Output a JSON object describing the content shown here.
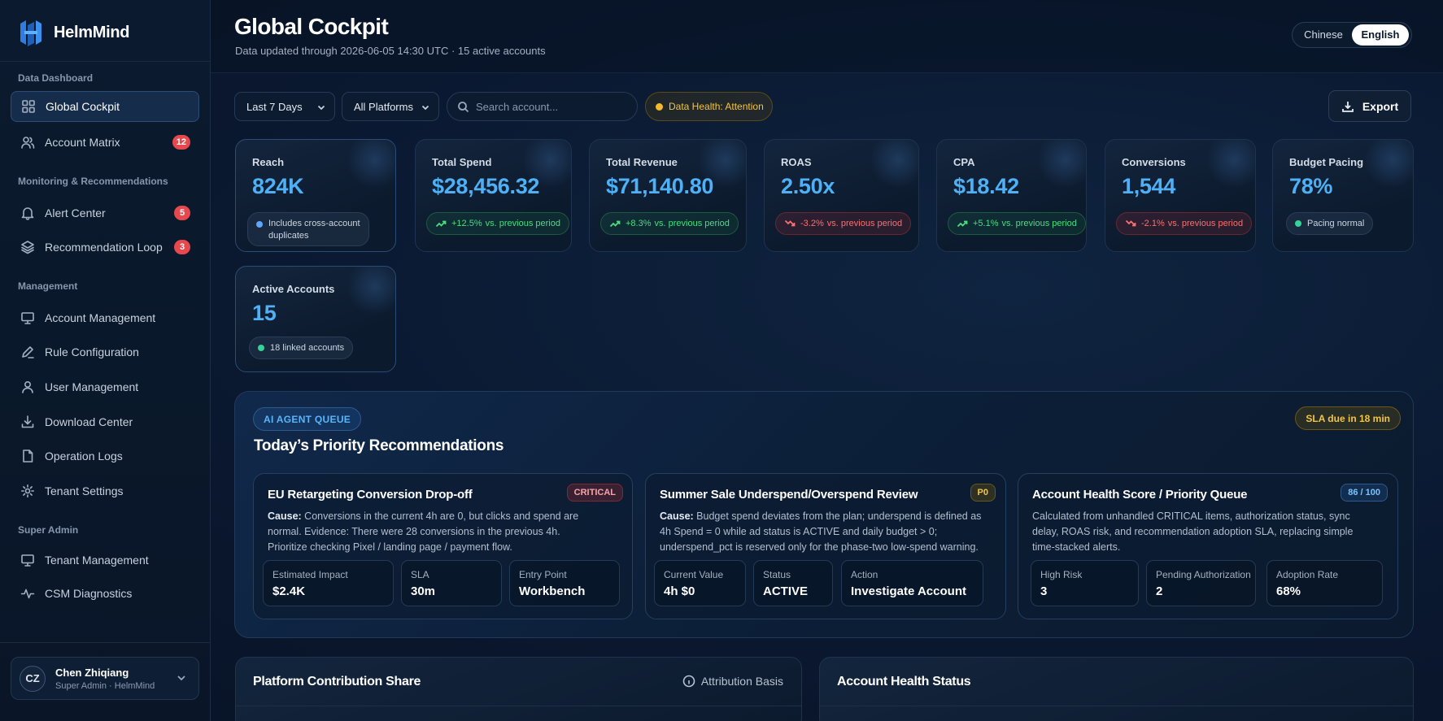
{
  "brand": {
    "name": "HelmMind"
  },
  "sidebar": {
    "sections": [
      {
        "label": "Data Dashboard"
      },
      {
        "label": "Monitoring & Recommendations"
      },
      {
        "label": "Management"
      },
      {
        "label": "Super Admin"
      }
    ],
    "items": [
      {
        "label": "Global Cockpit",
        "icon": "grid-icon",
        "active": true
      },
      {
        "label": "Account Matrix",
        "icon": "users-icon",
        "badge": "12"
      },
      {
        "label": "Alert Center",
        "icon": "bell-icon",
        "badge": "5"
      },
      {
        "label": "Recommendation Loop",
        "icon": "layers-icon",
        "badge": "3"
      },
      {
        "label": "Account Management",
        "icon": "monitor-icon"
      },
      {
        "label": "Rule Configuration",
        "icon": "pen-icon"
      },
      {
        "label": "User Management",
        "icon": "user-icon"
      },
      {
        "label": "Download Center",
        "icon": "download-icon"
      },
      {
        "label": "Operation Logs",
        "icon": "file-icon"
      },
      {
        "label": "Tenant Settings",
        "icon": "gear-icon"
      },
      {
        "label": "Tenant Management",
        "icon": "monitor-icon"
      },
      {
        "label": "CSM Diagnostics",
        "icon": "activity-icon"
      }
    ]
  },
  "user": {
    "initials": "CZ",
    "name": "Chen Zhiqiang",
    "role": "Super Admin · HelmMind"
  },
  "header": {
    "title": "Global Cockpit",
    "subtitle": "Data updated through 2026-06-05 14:30 UTC · 15 active accounts",
    "languages": [
      "Chinese",
      "English"
    ],
    "language_selected": "English"
  },
  "filters": {
    "date_range": "Last 7 Days",
    "platform": "All Platforms",
    "search_placeholder": "Search account...",
    "data_health": "Data Health: Attention",
    "export_label": "Export"
  },
  "kpis": [
    {
      "label": "Reach",
      "value": "824K",
      "note_line1": "Includes cross-account",
      "note_line2": "duplicates",
      "trend": "neutral"
    },
    {
      "label": "Total Spend",
      "value": "$28,456.32",
      "change": "+12.5%",
      "compare": "vs. previous period",
      "trend": "up"
    },
    {
      "label": "Total Revenue",
      "value": "$71,140.80",
      "change": "+8.3%",
      "compare": "vs. previous period",
      "trend": "up"
    },
    {
      "label": "ROAS",
      "value": "2.50x",
      "change": "-3.2%",
      "compare": "vs. previous period",
      "trend": "down"
    },
    {
      "label": "CPA",
      "value": "$18.42",
      "change": "+5.1%",
      "compare": "vs. previous period",
      "trend": "up"
    },
    {
      "label": "Conversions",
      "value": "1,544",
      "change": "-2.1%",
      "compare": "vs. previous period",
      "trend": "down"
    },
    {
      "label": "Budget Pacing",
      "value": "78%",
      "note_line1": "Pacing normal",
      "trend": "neutral"
    },
    {
      "label": "Active Accounts",
      "value": "15",
      "note_line1": "18 linked accounts",
      "trend": "neutral"
    }
  ],
  "queue": {
    "tag": "AI AGENT QUEUE",
    "title": "Today’s Priority Recommendations",
    "sla": "SLA due in 18 min",
    "cards": [
      {
        "title": "EU Retargeting Conversion Drop-off",
        "badge": "CRITICAL",
        "cause_label": "Cause:",
        "desc_line1": "Conversions in the current 4h are 0, but clicks and spend are",
        "desc_line2": "normal. Evidence: There were 28 conversions in the previous 4h.",
        "desc_line3": "Prioritize checking Pixel / landing page / payment flow.",
        "metrics": [
          {
            "label": "Estimated Impact",
            "value": "$2.4K"
          },
          {
            "label": "SLA",
            "value": "30m"
          },
          {
            "label": "Entry Point",
            "value": "Workbench"
          }
        ]
      },
      {
        "title": "Summer Sale Underspend/Overspend Review",
        "badge": "P0",
        "cause_label": "Cause:",
        "desc_line1": "Budget spend deviates from the plan; underspend is defined as",
        "desc_line2": "4h Spend = 0 while ad status is ACTIVE and daily budget > 0;",
        "desc_line3": "underspend_pct is reserved only for the phase-two low-spend warning.",
        "metrics": [
          {
            "label": "Current Value",
            "value": "4h $0"
          },
          {
            "label": "Status",
            "value": "ACTIVE"
          },
          {
            "label": "Action",
            "value": "Investigate Account"
          }
        ]
      },
      {
        "title": "Account Health Score / Priority Queue",
        "badge": "86 / 100",
        "desc_line1": "Calculated from unhandled CRITICAL items, authorization status, sync",
        "desc_line2": "delay, ROAS risk, and recommendation adoption SLA, replacing simple",
        "desc_line3": "time-stacked alerts.",
        "metrics": [
          {
            "label": "High Risk",
            "value": "3"
          },
          {
            "label": "Pending Authorization",
            "value": "2"
          },
          {
            "label": "Adoption Rate",
            "value": "68%"
          }
        ]
      }
    ]
  },
  "panels": {
    "platform": {
      "title": "Platform Contribution Share",
      "attribution": "Attribution Basis"
    },
    "health": {
      "title": "Account Health Status"
    }
  }
}
